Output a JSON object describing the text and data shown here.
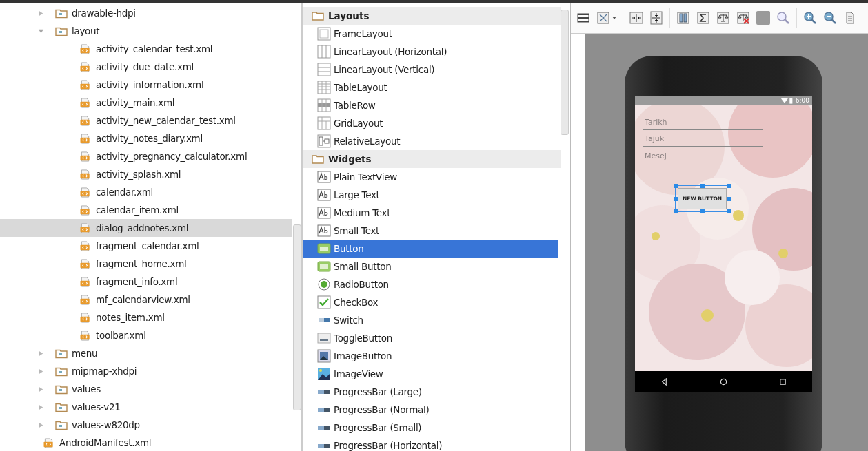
{
  "project_tree": [
    {
      "label": "drawable-hdpi",
      "kind": "folder",
      "expanded": false,
      "selected": false
    },
    {
      "label": "layout",
      "kind": "folder",
      "expanded": true,
      "selected": false,
      "children": [
        {
          "label": "activity_calendar_test.xml",
          "kind": "file",
          "selected": false
        },
        {
          "label": "activity_due_date.xml",
          "kind": "file",
          "selected": false
        },
        {
          "label": "activity_information.xml",
          "kind": "file",
          "selected": false
        },
        {
          "label": "activity_main.xml",
          "kind": "file",
          "selected": false
        },
        {
          "label": "activity_new_calendar_test.xml",
          "kind": "file",
          "selected": false
        },
        {
          "label": "activity_notes_diary.xml",
          "kind": "file",
          "selected": false
        },
        {
          "label": "activity_pregnancy_calculator.xml",
          "kind": "file",
          "selected": false
        },
        {
          "label": "activity_splash.xml",
          "kind": "file",
          "selected": false
        },
        {
          "label": "calendar.xml",
          "kind": "file",
          "selected": false
        },
        {
          "label": "calendar_item.xml",
          "kind": "file",
          "selected": false
        },
        {
          "label": "dialog_addnotes.xml",
          "kind": "file",
          "selected": true
        },
        {
          "label": "fragment_calendar.xml",
          "kind": "file",
          "selected": false
        },
        {
          "label": "fragment_home.xml",
          "kind": "file",
          "selected": false
        },
        {
          "label": "fragment_info.xml",
          "kind": "file",
          "selected": false
        },
        {
          "label": "mf_calendarview.xml",
          "kind": "file",
          "selected": false
        },
        {
          "label": "notes_item.xml",
          "kind": "file",
          "selected": false
        },
        {
          "label": "toolbar.xml",
          "kind": "file",
          "selected": false
        }
      ]
    },
    {
      "label": "menu",
      "kind": "folder",
      "expanded": false,
      "selected": false
    },
    {
      "label": "mipmap-xhdpi",
      "kind": "folder",
      "expanded": false,
      "selected": false
    },
    {
      "label": "values",
      "kind": "folder",
      "expanded": false,
      "selected": false
    },
    {
      "label": "values-v21",
      "kind": "folder",
      "expanded": false,
      "selected": false
    },
    {
      "label": "values-w820dp",
      "kind": "folder",
      "expanded": false,
      "selected": false
    },
    {
      "label": "AndroidManifest.xml",
      "kind": "file",
      "selected": false
    }
  ],
  "palette": [
    {
      "group": "Layouts",
      "items": [
        {
          "label": "FrameLayout",
          "kind": "frame",
          "selected": false
        },
        {
          "label": "LinearLayout (Horizontal)",
          "kind": "hlinear",
          "selected": false
        },
        {
          "label": "LinearLayout (Vertical)",
          "kind": "vlinear",
          "selected": false
        },
        {
          "label": "TableLayout",
          "kind": "table",
          "selected": false
        },
        {
          "label": "TableRow",
          "kind": "tablerow",
          "selected": false
        },
        {
          "label": "GridLayout",
          "kind": "grid",
          "selected": false
        },
        {
          "label": "RelativeLayout",
          "kind": "relative",
          "selected": false
        }
      ]
    },
    {
      "group": "Widgets",
      "items": [
        {
          "label": "Plain TextView",
          "kind": "text",
          "selected": false
        },
        {
          "label": "Large Text",
          "kind": "text",
          "selected": false
        },
        {
          "label": "Medium Text",
          "kind": "text",
          "selected": false
        },
        {
          "label": "Small Text",
          "kind": "text",
          "selected": false
        },
        {
          "label": "Button",
          "kind": "button",
          "selected": true
        },
        {
          "label": "Small Button",
          "kind": "button",
          "selected": false
        },
        {
          "label": "RadioButton",
          "kind": "radio",
          "selected": false
        },
        {
          "label": "CheckBox",
          "kind": "checkbox",
          "selected": false
        },
        {
          "label": "Switch",
          "kind": "switch",
          "selected": false
        },
        {
          "label": "ToggleButton",
          "kind": "toggle",
          "selected": false
        },
        {
          "label": "ImageButton",
          "kind": "imagebutton",
          "selected": false
        },
        {
          "label": "ImageView",
          "kind": "imageview",
          "selected": false
        },
        {
          "label": "ProgressBar (Large)",
          "kind": "progress",
          "selected": false
        },
        {
          "label": "ProgressBar (Normal)",
          "kind": "progress",
          "selected": false
        },
        {
          "label": "ProgressBar (Small)",
          "kind": "progress",
          "selected": false
        },
        {
          "label": "ProgressBar (Horizontal)",
          "kind": "progress",
          "selected": false
        }
      ]
    }
  ],
  "preview": {
    "status_time": "6:00",
    "fields": [
      {
        "placeholder": "Tarikh",
        "kind": "single"
      },
      {
        "placeholder": "Tajuk",
        "kind": "single"
      },
      {
        "placeholder": "Mesej",
        "kind": "multi"
      }
    ],
    "button": {
      "label": "NEW BUTTON",
      "selected": true
    }
  }
}
